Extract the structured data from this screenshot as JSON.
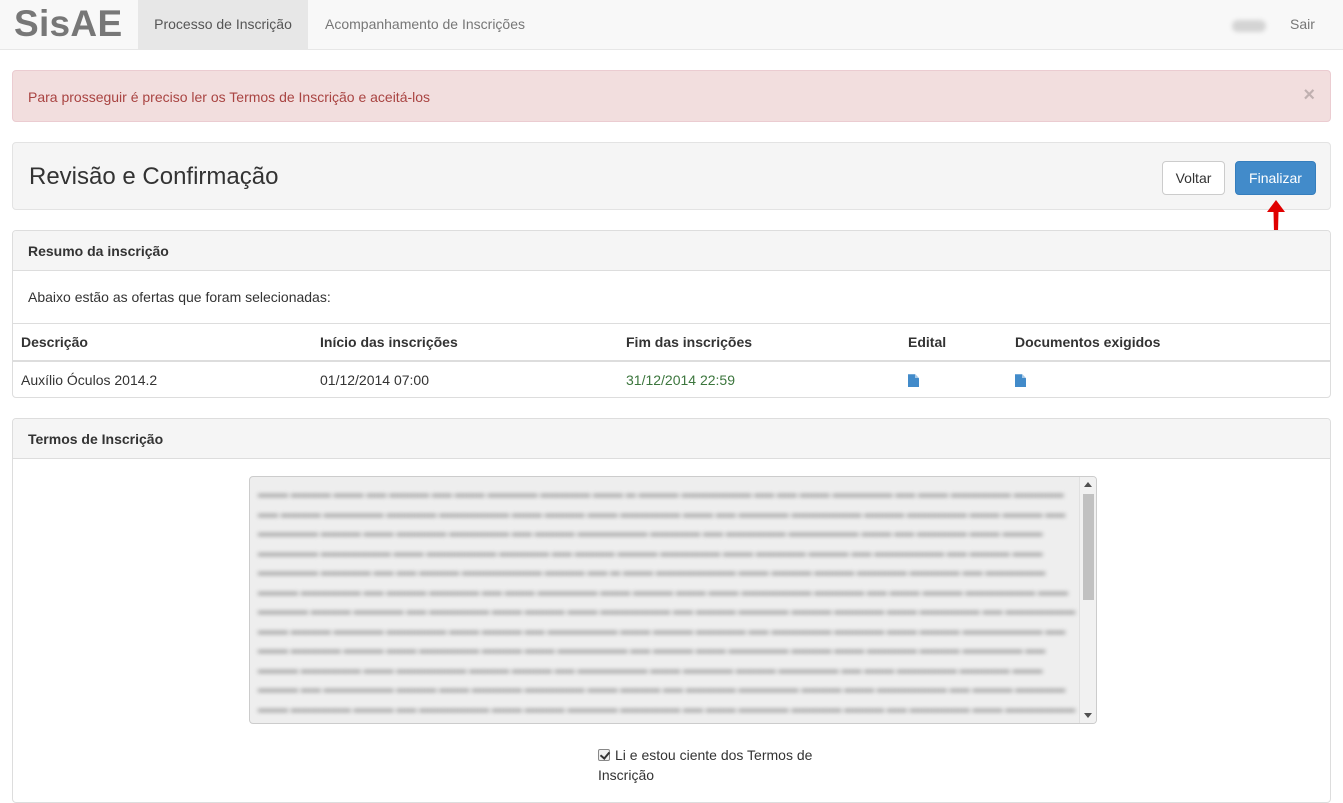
{
  "navbar": {
    "brand": "SisAE",
    "tabs": [
      {
        "label": "Processo de Inscrição",
        "active": true
      },
      {
        "label": "Acompanhamento de Inscrições",
        "active": false
      }
    ],
    "logout_label": "Sair"
  },
  "alert": {
    "message": "Para prosseguir é preciso ler os Termos de Inscrição e aceitá-los",
    "close_symbol": "×"
  },
  "header": {
    "title": "Revisão e Confirmação",
    "back_label": "Voltar",
    "finish_label": "Finalizar"
  },
  "summary": {
    "heading": "Resumo da inscrição",
    "intro": "Abaixo estão as ofertas que foram selecionadas:",
    "columns": [
      "Descrição",
      "Início das inscrições",
      "Fim das inscrições",
      "Edital",
      "Documentos exigidos"
    ],
    "rows": [
      {
        "description": "Auxílio Óculos 2014.2",
        "start": "01/12/2014 07:00",
        "end": "31/12/2014 22:59",
        "edital_icon": "file-icon",
        "documents_icon": "file-icon"
      }
    ]
  },
  "terms": {
    "heading": "Termos de Inscrição",
    "checkbox_checked": true,
    "checkbox_label": "Li e estou ciente dos Termos de Inscrição"
  },
  "colors": {
    "primary": "#428bca",
    "alert_text": "#a94442",
    "alert_bg": "#f2dede",
    "end_date": "#3c763d",
    "annotation_arrow": "#e00000"
  }
}
